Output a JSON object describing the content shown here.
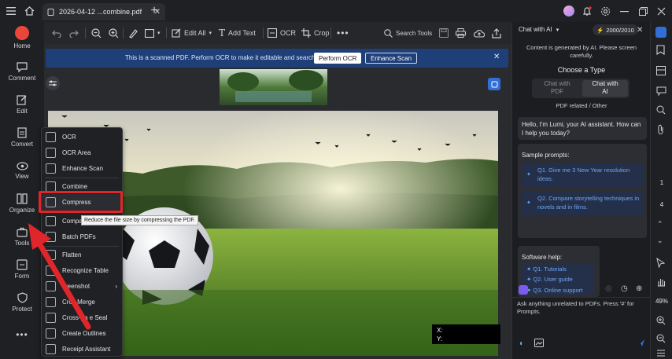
{
  "tab": {
    "title": "2026-04-12 ...combine.pdf"
  },
  "sidebar": {
    "items": [
      {
        "label": "Home"
      },
      {
        "label": "Comment"
      },
      {
        "label": "Edit"
      },
      {
        "label": "Convert"
      },
      {
        "label": "View"
      },
      {
        "label": "Organize"
      },
      {
        "label": "Tools"
      },
      {
        "label": "Form"
      },
      {
        "label": "Protect"
      }
    ]
  },
  "toolbar": {
    "edit_all": "Edit All",
    "add_text": "Add Text",
    "ocr": "OCR",
    "crop": "Crop",
    "search_tools": "Search Tools"
  },
  "banner": {
    "text": "This is a scanned PDF. Perform OCR to make it editable and searchable.",
    "perform_ocr": "Perform OCR",
    "enhance_scan": "Enhance Scan"
  },
  "tools_menu": {
    "items": [
      "OCR",
      "OCR Area",
      "Enhance Scan",
      "Combine",
      "Compress",
      "Compa",
      "Batch PDFs",
      "Flatten",
      "Recognize Table",
      "creenshot",
      "Cros Merge",
      "Cross-pa e Seal",
      "Create Outlines",
      "Receipt Assistant"
    ],
    "tooltip": "Reduce the file size by compressing the PDF."
  },
  "coords": {
    "x_label": "X:",
    "y_label": "Y:"
  },
  "chat": {
    "mode": "Chat with AI",
    "credits": "2000/2010",
    "disclaimer": "Content is generated by AI. Please screen carefully.",
    "choose_type": "Choose a Type",
    "type_pdf_line1": "Chat with",
    "type_pdf_line2": "PDF",
    "type_ai_line1": "Chat with",
    "type_ai_line2": "AI",
    "category": "PDF related / Other",
    "greeting": "Hello, I'm Lumi, your AI assistant. How can I help you today?",
    "sample_title": "Sample prompts:",
    "prompts": [
      "Q1. Give me 3 New Year resolution ideas.",
      "Q2. Compare storytelling techniques in novels and in films."
    ],
    "help_title": "Software help:",
    "help_links": [
      "Q1. Tutorials",
      "Q2. User guide",
      "Q3. Online support"
    ],
    "input_placeholder": "Ask anything unrelated to PDFs. Press '#' for Prompts."
  },
  "right_strip": {
    "page_current": "1",
    "page_total": "4",
    "zoom": "49%"
  },
  "colors": {
    "accent": "#2f6fd6",
    "highlight": "#e0262a",
    "banner": "#1f3f78"
  }
}
